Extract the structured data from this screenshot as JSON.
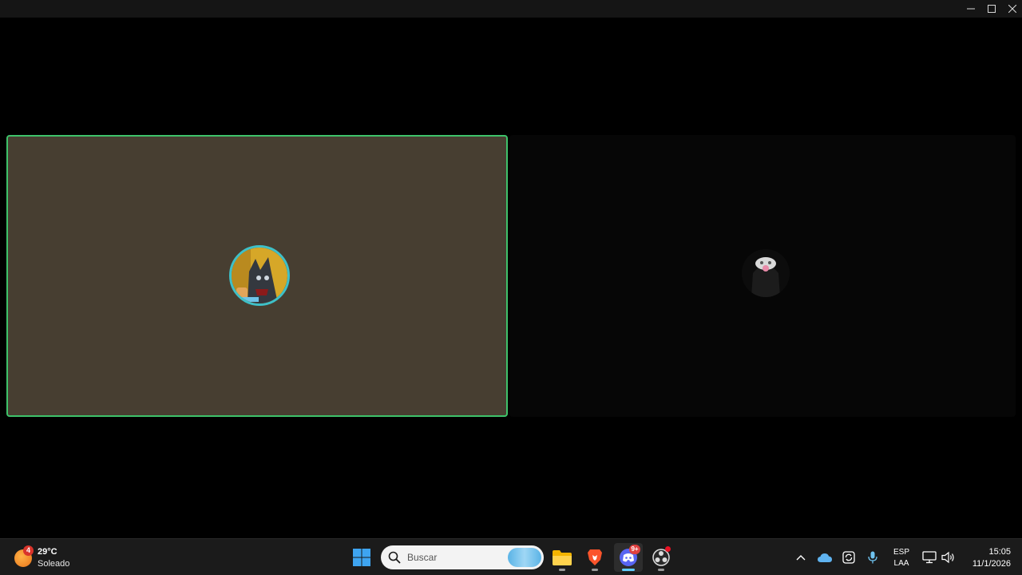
{
  "window": {
    "controls": [
      "minimize-icon",
      "maximize-icon",
      "close-icon"
    ]
  },
  "call": {
    "active_speaker_border": "#3ec26a",
    "tiles": [
      {
        "avatar_icon": "avatar",
        "background": "#473e31",
        "speaking": true
      },
      {
        "avatar_icon": "avatar",
        "background": "#060606",
        "speaking": false
      }
    ]
  },
  "taskbar": {
    "weather": {
      "badge": "4",
      "temperature": "29°C",
      "condition": "Soleado"
    },
    "search": {
      "placeholder": "Buscar"
    },
    "apps": [
      {
        "name": "start",
        "icon": "windows-logo-icon"
      },
      {
        "name": "file-explorer",
        "icon": "folder-icon"
      },
      {
        "name": "brave",
        "icon": "brave-lion-icon"
      },
      {
        "name": "discord",
        "icon": "discord-icon",
        "badge": "9+"
      },
      {
        "name": "obs",
        "icon": "obs-icon"
      }
    ],
    "tray": {
      "icons": [
        "chevron-up-icon",
        "onedrive-icon",
        "sync-icon",
        "microphone-icon",
        "network-icon",
        "volume-icon"
      ],
      "language": {
        "line1": "ESP",
        "line2": "LAA"
      },
      "time": "15:05",
      "date": "11/1/2026"
    }
  }
}
